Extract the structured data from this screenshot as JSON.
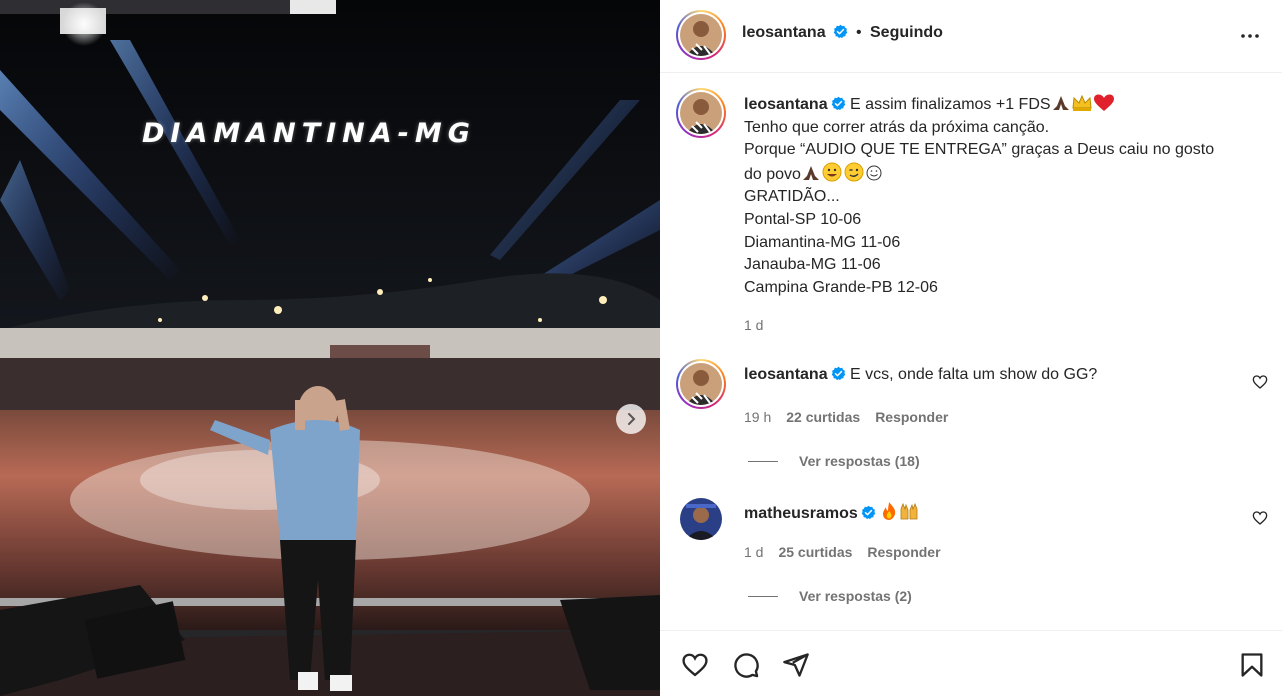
{
  "post": {
    "media": {
      "overlay_text": "Diamantina-MG",
      "next_icon": "chevron-right-icon"
    },
    "header": {
      "username": "leosantana",
      "separator": "•",
      "follow_status": "Seguindo",
      "more_icon": "more-horizontal-icon"
    },
    "caption": {
      "username": "leosantana",
      "lines": [
        "E assim finalizamos +1 FDS",
        "Tenho que correr atrás da próxima canção.",
        "Porque “AUDIO QUE TE ENTREGA” graças a Deus caiu no gosto",
        "do povo",
        "GRATIDÃO...",
        "Pontal-SP 10-06",
        "Diamantina-MG 11-06",
        "Janauba-MG 11-06",
        "Campina Grande-PB 12-06"
      ],
      "emoji_line1": [
        "praying-hands",
        "crown",
        "red-heart"
      ],
      "emoji_line4": [
        "praying-hands",
        "grinning-face",
        "winking-face",
        "smiling-face"
      ],
      "time": "1 d"
    },
    "comments": [
      {
        "username": "leosantana",
        "text": "E vcs, onde falta um show do GG?",
        "time": "19 h",
        "likes": "22 curtidas",
        "reply_label": "Responder",
        "view_replies": "Ver respostas (18)"
      },
      {
        "username": "matheusramos",
        "text": "",
        "emojis": [
          "fire",
          "raising-hands"
        ],
        "time": "1 d",
        "likes": "25 curtidas",
        "reply_label": "Responder",
        "view_replies": "Ver respostas (2)"
      }
    ],
    "actions": [
      "heart-icon",
      "comment-icon",
      "share-icon",
      "bookmark-icon"
    ]
  },
  "colors": {
    "text": "#262626",
    "secondary": "#737373",
    "verified": "#0095f6",
    "divider": "#efefef"
  }
}
